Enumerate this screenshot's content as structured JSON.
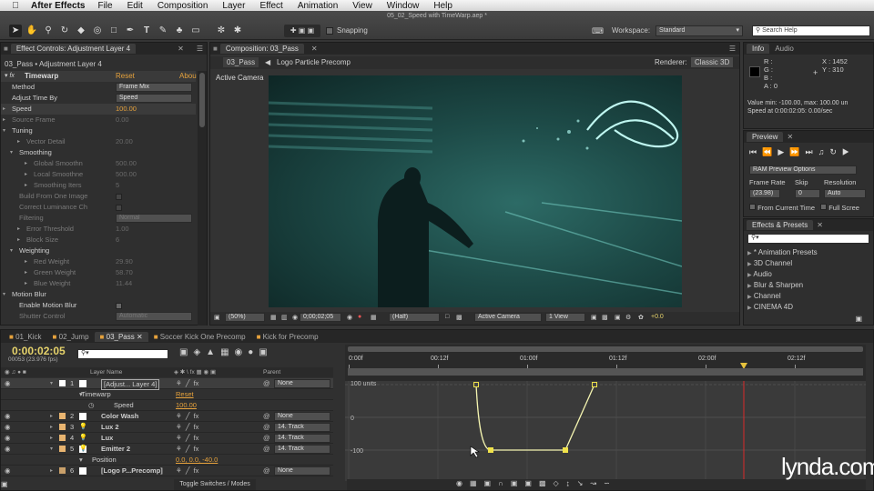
{
  "menubar": {
    "app": "After Effects",
    "items": [
      "File",
      "Edit",
      "Composition",
      "Layer",
      "Effect",
      "Animation",
      "View",
      "Window",
      "Help"
    ]
  },
  "window_title": "05_02_Speed with TimeWarp.aep *",
  "toolbar": {
    "snapping_label": "Snapping",
    "workspace_label": "Workspace:",
    "workspace_value": "Standard",
    "search_placeholder": "Search Help"
  },
  "effect_controls": {
    "tab": "Effect Controls: Adjustment Layer 4",
    "breadcrumb": "03_Pass • Adjustment Layer 4",
    "effect_name": "Timewarp",
    "reset": "Reset",
    "about": "Abou",
    "params": [
      {
        "label": "Method",
        "value": "Frame Mix",
        "kind": "dropdown"
      },
      {
        "label": "Adjust Time By",
        "value": "Speed",
        "kind": "dropdown"
      },
      {
        "label": "Speed",
        "value": "100.00",
        "kind": "value",
        "active": true
      },
      {
        "label": "Source Frame",
        "value": "0.00",
        "kind": "value",
        "dim": true
      },
      {
        "label": "Tuning",
        "value": "",
        "kind": "group"
      },
      {
        "label": "Vector Detail",
        "value": "20.00",
        "kind": "value",
        "dim": true,
        "indent": 2
      },
      {
        "label": "Smoothing",
        "value": "",
        "kind": "group",
        "indent": 1
      },
      {
        "label": "Global Smoothn",
        "value": "500.00",
        "kind": "value",
        "dim": true,
        "indent": 3
      },
      {
        "label": "Local Smoothne",
        "value": "500.00",
        "kind": "value",
        "dim": true,
        "indent": 3
      },
      {
        "label": "Smoothing Iters",
        "value": "5",
        "kind": "value",
        "dim": true,
        "indent": 3
      },
      {
        "label": "Build From One Image",
        "value": "",
        "kind": "check",
        "dim": true,
        "indent": 1
      },
      {
        "label": "Correct Luminance Ch",
        "value": "",
        "kind": "check",
        "dim": true,
        "indent": 1
      },
      {
        "label": "Filtering",
        "value": "Normal",
        "kind": "dropdown",
        "dim": true,
        "indent": 1
      },
      {
        "label": "Error Threshold",
        "value": "1.00",
        "kind": "value",
        "dim": true,
        "indent": 2
      },
      {
        "label": "Block Size",
        "value": "6",
        "kind": "value",
        "dim": true,
        "indent": 2
      },
      {
        "label": "Weighting",
        "value": "",
        "kind": "group",
        "indent": 1
      },
      {
        "label": "Red Weight",
        "value": "29.90",
        "kind": "value",
        "dim": true,
        "indent": 3
      },
      {
        "label": "Green Weight",
        "value": "58.70",
        "kind": "value",
        "dim": true,
        "indent": 3
      },
      {
        "label": "Blue Weight",
        "value": "11.44",
        "kind": "value",
        "dim": true,
        "indent": 3
      },
      {
        "label": "Motion Blur",
        "value": "",
        "kind": "group"
      },
      {
        "label": "Enable Motion Blur",
        "value": "",
        "kind": "check",
        "indent": 1
      },
      {
        "label": "Shutter Control",
        "value": "Automatic",
        "kind": "dropdown",
        "dim": true,
        "indent": 1
      }
    ]
  },
  "composition": {
    "tab": "Composition: 03_Pass",
    "flow": [
      "03_Pass",
      "Logo Particle Precomp"
    ],
    "renderer_label": "Renderer:",
    "renderer_value": "Classic 3D",
    "camera_label": "Active Camera",
    "zoom": "(50%)",
    "timecode": "0;00;02;05",
    "resolution": "(Half)",
    "view": "Active Camera",
    "views": "1 View",
    "exposure": "+0.0"
  },
  "info": {
    "tab1": "Info",
    "tab2": "Audio",
    "r": "R :",
    "g": "G :",
    "b": "B :",
    "a": "A : 0",
    "x": "X : 1452",
    "y": "Y : 310",
    "line1": "Value min: -100.00, max: 100.00 un",
    "line2": "Speed at 0:00:02:05: 0.00/sec"
  },
  "preview": {
    "tab": "Preview",
    "ram": "RAM Preview Options",
    "frame_rate_label": "Frame Rate",
    "skip_label": "Skip",
    "resolution_label": "Resolution",
    "frame_rate": "(23.98)",
    "skip": "0",
    "resolution": "Auto",
    "from_current": "From Current Time",
    "full_screen": "Full Scree"
  },
  "effects_presets": {
    "tab": "Effects & Presets",
    "items": [
      "* Animation Presets",
      "3D Channel",
      "Audio",
      "Blur & Sharpen",
      "Channel",
      "CINEMA 4D"
    ]
  },
  "timeline": {
    "tabs": [
      "01_Kick",
      "02_Jump",
      "03_Pass",
      "Soccer Kick One Precomp",
      "Kick for Precomp"
    ],
    "timecode": "0:00:02:05",
    "fps": "00053 (23.976 fps)",
    "col_layer": "Layer Name",
    "col_parent": "Parent",
    "ruler": [
      "0:00f",
      "00:12f",
      "01:00f",
      "01:12f",
      "02:00f",
      "02:12f"
    ],
    "layers": [
      {
        "num": "1",
        "name": "[Adjust... Layer 4]",
        "color": "#ffffff",
        "parent": "None",
        "selected": true
      },
      {
        "num": "",
        "name": "Timewarp",
        "sub": true,
        "extra": "Reset"
      },
      {
        "num": "",
        "name": "Speed",
        "sub": true,
        "extra": "100.00",
        "stopwatch": true
      },
      {
        "num": "2",
        "name": "Color Wash",
        "color": "#e8b470",
        "parent": "None"
      },
      {
        "num": "3",
        "name": "Lux 2",
        "color": "#e8b470",
        "parent": "14. Track"
      },
      {
        "num": "4",
        "name": "Lux",
        "color": "#e8b470",
        "parent": "14. Track"
      },
      {
        "num": "5",
        "name": "Emitter 2",
        "color": "#e8b470",
        "parent": "14. Track"
      },
      {
        "num": "",
        "name": "Position",
        "sub": true,
        "extra": "0.0, 0.0, -40.0"
      },
      {
        "num": "6",
        "name": "[Logo P...Precomp]",
        "color": "#c9a06a",
        "parent": "None"
      }
    ],
    "graph_labels": {
      "top": "100 units",
      "mid": "0",
      "bot": "-100"
    },
    "toggle": "Toggle Switches / Modes"
  },
  "watermark": "lynda.com",
  "colors": {
    "accent": "#e6a23c",
    "graph_curve": "#f4f4b0",
    "keyframe": "#f0e24a",
    "playhead": "#d92b2b"
  },
  "chart_data": {
    "type": "line",
    "series": [
      {
        "values": [
          100,
          -100,
          -100,
          100
        ]
      }
    ],
    "ylim": [
      -100,
      100
    ],
    "ylabel": "",
    "xlabel": ""
  }
}
